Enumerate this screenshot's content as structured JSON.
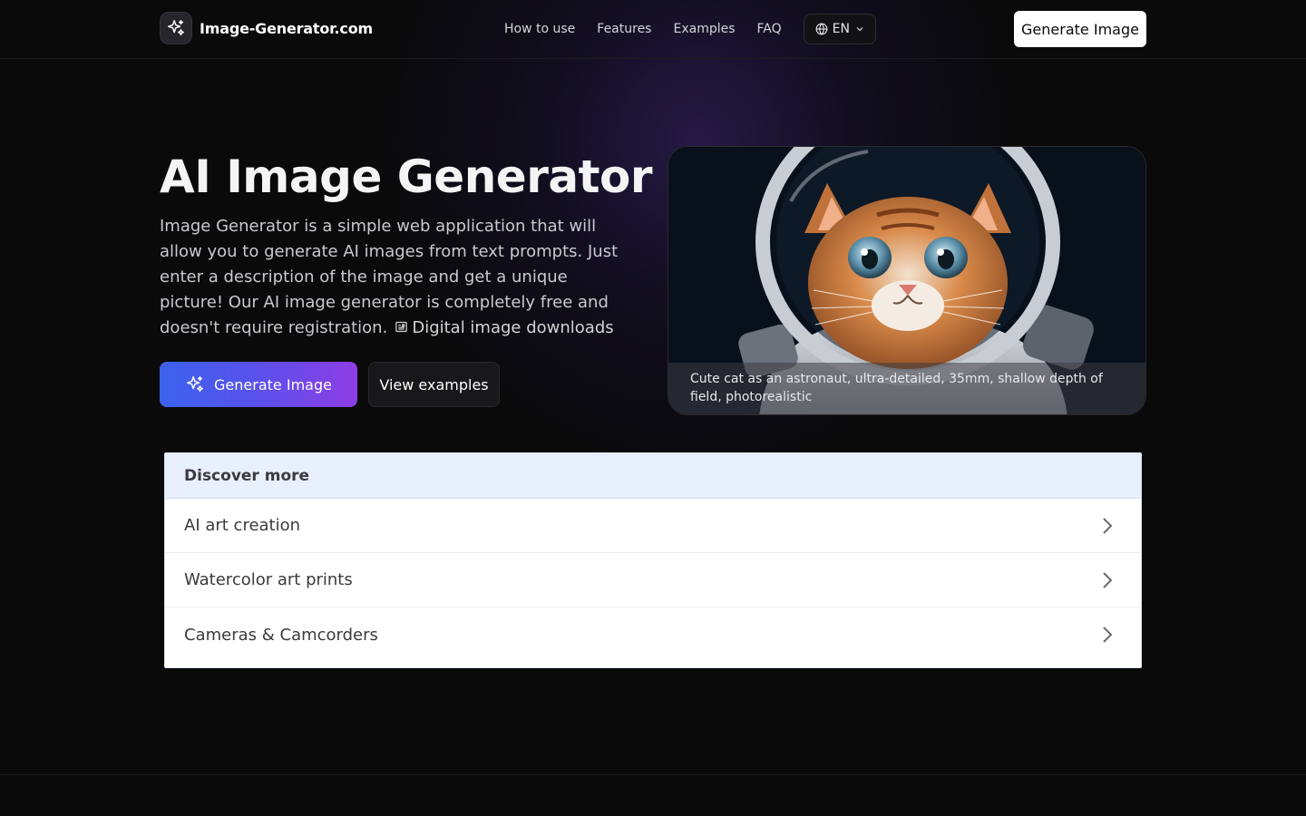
{
  "header": {
    "brand": "Image-Generator.com",
    "nav": [
      "How to use",
      "Features",
      "Examples",
      "FAQ"
    ],
    "language": "EN",
    "cta_label": "Generate Image"
  },
  "hero": {
    "title": "AI Image Generator",
    "description": "Image Generator is a simple web application that will allow you to generate AI images from text prompts. Just enter a description of the image and get a unique picture! Our AI image generator is completely free and doesn't require registration.",
    "download_link": "Digital image downloads",
    "primary_button": "Generate Image",
    "secondary_button": "View examples",
    "image_caption": "Cute cat as an astronaut, ultra-detailed, 35mm, shallow depth of field, photorealistic"
  },
  "discover": {
    "heading": "Discover more",
    "items": [
      "AI art creation",
      "Watercolor art prints",
      "Cameras & Camcorders"
    ]
  },
  "colors": {
    "background": "#0a0a0b",
    "accent_gradient_start": "#3b63ee",
    "accent_gradient_end": "#8e3de4",
    "discover_header": "#e8effd"
  }
}
